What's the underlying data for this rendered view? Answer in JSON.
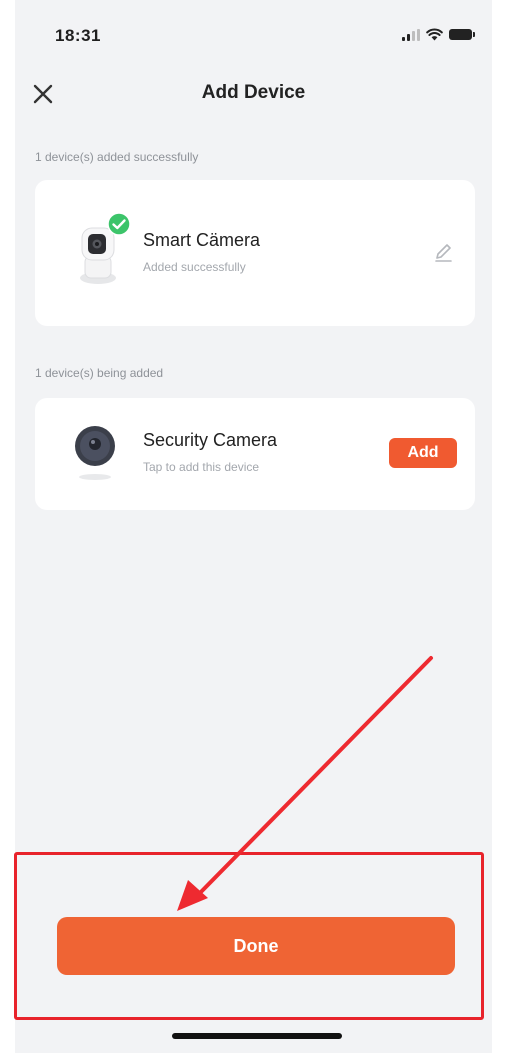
{
  "status_bar": {
    "time": "18:31",
    "icons": [
      "signal-icon",
      "wifi-icon",
      "battery-icon"
    ]
  },
  "nav": {
    "title": "Add Device",
    "close_icon": "close-icon"
  },
  "sections": [
    {
      "label": "1 device(s) added successfully",
      "device": {
        "name": "Smart Cämera",
        "status": "Added successfully",
        "image_icon": "smart-camera-image",
        "badge_icon": "check-circle-icon",
        "action_icon": "edit-pencil-icon"
      }
    },
    {
      "label": "1 device(s) being added",
      "device": {
        "name": "Security Camera",
        "status": "Tap to add this device",
        "image_icon": "security-camera-image",
        "action_label": "Add"
      }
    }
  ],
  "footer": {
    "done_label": "Done"
  },
  "colors": {
    "accent": "#ef6434",
    "success": "#3cc46a",
    "annotation": "#e8232b",
    "background": "#f2f3f5"
  }
}
